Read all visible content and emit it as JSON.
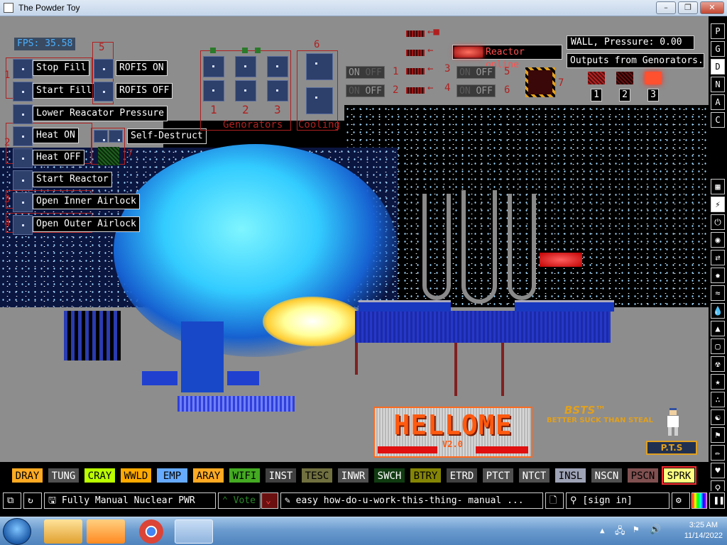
{
  "window": {
    "title": "The Powder Toy"
  },
  "hud": {
    "fps": "FPS: 35.58",
    "wall_info": "WALL, Pressure: 0.00",
    "outputs_info": "Outputs from Genorators.",
    "reactor_status": "Reactor online",
    "left_buttons": [
      "Stop Fill",
      "Start Fill",
      "Lower Reacator Pressure",
      "Heat ON",
      "Heat OFF",
      "Start Reactor",
      "Open Inner Airlock",
      "Open Outer Airlock"
    ],
    "rofis_on": "ROFIS ON",
    "rofis_off": "ROFIS OFF",
    "self_destruct": "Self-Destruct",
    "group_numbers": [
      "1",
      "2",
      "3",
      "4",
      "5",
      "6",
      "7"
    ],
    "generator_numbers": [
      "1",
      "2",
      "3"
    ],
    "generators_label": "Genorators",
    "cooling_label": "Cooling",
    "switch_on": "ON",
    "switch_off": "OFF",
    "output_numbers": [
      "1",
      "2",
      "3"
    ]
  },
  "sign": {
    "title": "HELLOME",
    "version": "V2.0"
  },
  "tagline": {
    "logo": "BSTS™",
    "text": "BETTER SUCK THAN STEAL"
  },
  "badge": "P.T.S",
  "sidebar": [
    "P",
    "G",
    "D",
    "N",
    "A",
    "C"
  ],
  "element_bar": [
    {
      "label": "DRAY",
      "bg": "#ffaa22",
      "fg": "#000"
    },
    {
      "label": "TUNG",
      "bg": "#505050",
      "fg": "#fff"
    },
    {
      "label": "CRAY",
      "bg": "#bbff00",
      "fg": "#000"
    },
    {
      "label": "WWLD",
      "bg": "#ffaa00",
      "fg": "#000"
    },
    {
      "label": "EMP",
      "bg": "#66aaff",
      "fg": "#000"
    },
    {
      "label": "ARAY",
      "bg": "#ffaa22",
      "fg": "#000"
    },
    {
      "label": "WIFI",
      "bg": "#44aa22",
      "fg": "#000"
    },
    {
      "label": "INST",
      "bg": "#404040",
      "fg": "#fff"
    },
    {
      "label": "TESC",
      "bg": "#707040",
      "fg": "#000"
    },
    {
      "label": "INWR",
      "bg": "#505050",
      "fg": "#fff"
    },
    {
      "label": "SWCH",
      "bg": "#103b11",
      "fg": "#fff"
    },
    {
      "label": "BTRY",
      "bg": "#858505",
      "fg": "#000"
    },
    {
      "label": "ETRD",
      "bg": "#404040",
      "fg": "#fff"
    },
    {
      "label": "PTCT",
      "bg": "#505050",
      "fg": "#fff"
    },
    {
      "label": "NTCT",
      "bg": "#505050",
      "fg": "#fff"
    },
    {
      "label": "INSL",
      "bg": "#9ea3b6",
      "fg": "#000"
    },
    {
      "label": "NSCN",
      "bg": "#505050",
      "fg": "#fff"
    },
    {
      "label": "PSCN",
      "bg": "#805050",
      "fg": "#000"
    },
    {
      "label": "SPRK",
      "bg": "#ffff80",
      "fg": "#000"
    }
  ],
  "bottom_bar": {
    "save_name": "Fully Manual Nuclear PWR",
    "vote": "Vote",
    "tags": "easy how-do-u-work-this-thing- manual ...",
    "sign_in": "[sign in]"
  },
  "taskbar": {
    "time": "3:25 AM",
    "date": "11/14/2022"
  }
}
